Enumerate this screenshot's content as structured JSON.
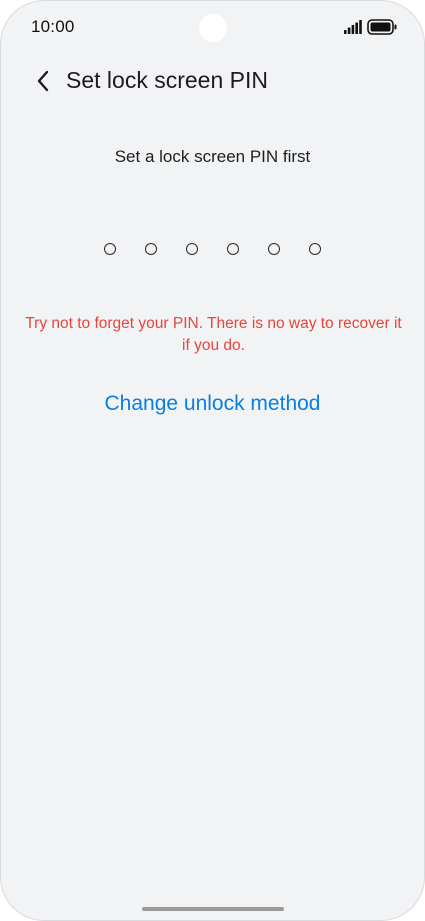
{
  "status_bar": {
    "time": "10:00",
    "signal_icon": "signal-icon",
    "battery_icon": "battery-icon"
  },
  "header": {
    "back_icon": "chevron-left-icon",
    "title": "Set lock screen PIN"
  },
  "main": {
    "prompt": "Set a lock screen PIN first",
    "pin_length": 6,
    "pin_entered": 0,
    "warning": "Try not to forget your PIN. There is no way to recover it if you do.",
    "change_method_label": "Change unlock method"
  },
  "colors": {
    "background": "#f2f3f5",
    "warning": "#e8453c",
    "link": "#0a7fe0"
  }
}
